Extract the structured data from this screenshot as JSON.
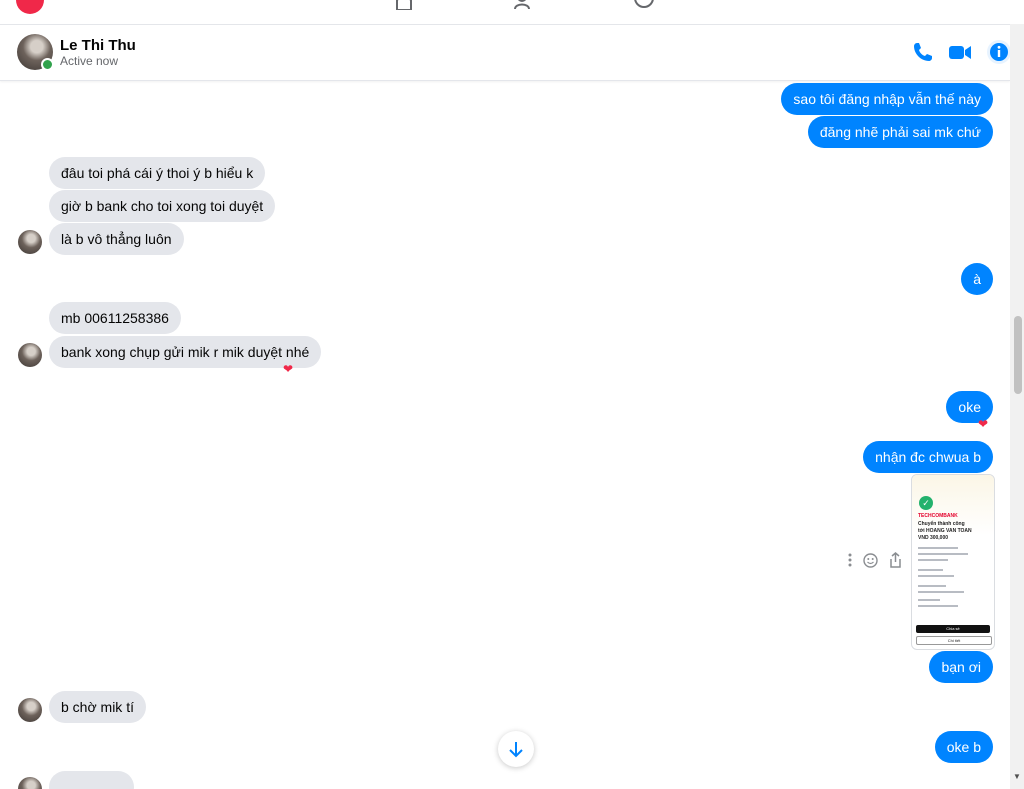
{
  "header": {
    "contact_name": "Le Thi Thu",
    "status": "Active now"
  },
  "messages": {
    "m1": "sao tôi đăng nhập vẫn thế này",
    "m2": "đăng nhẽ phải sai mk chứ",
    "m3": "đâu toi phá cái ý thoi ý b hiểu k",
    "m4": "giờ b bank cho toi xong toi duyệt",
    "m5": "là b vô thẳng luôn",
    "m6": "à",
    "m7": "mb 00611258386",
    "m8": "bank xong chụp gửi mik r mik duyệt nhé",
    "m9": "oke",
    "m10": "nhận đc chwua b",
    "m11": "bạn ơi",
    "m12": "b chờ mik tí",
    "m13": "oke b"
  },
  "receipt": {
    "bank": "TECHCOMBANK",
    "title": "Chuyển thành công",
    "recipient": "tới HOANG VAN TOAN",
    "amount": "VND 300,000",
    "primary_button": "Chia sẻ",
    "secondary_button": "Chi tiết"
  },
  "colors": {
    "outgoing_bubble": "#0084ff",
    "incoming_bubble": "#e4e6eb",
    "reaction_heart": "#f02849",
    "online": "#31a24c"
  }
}
